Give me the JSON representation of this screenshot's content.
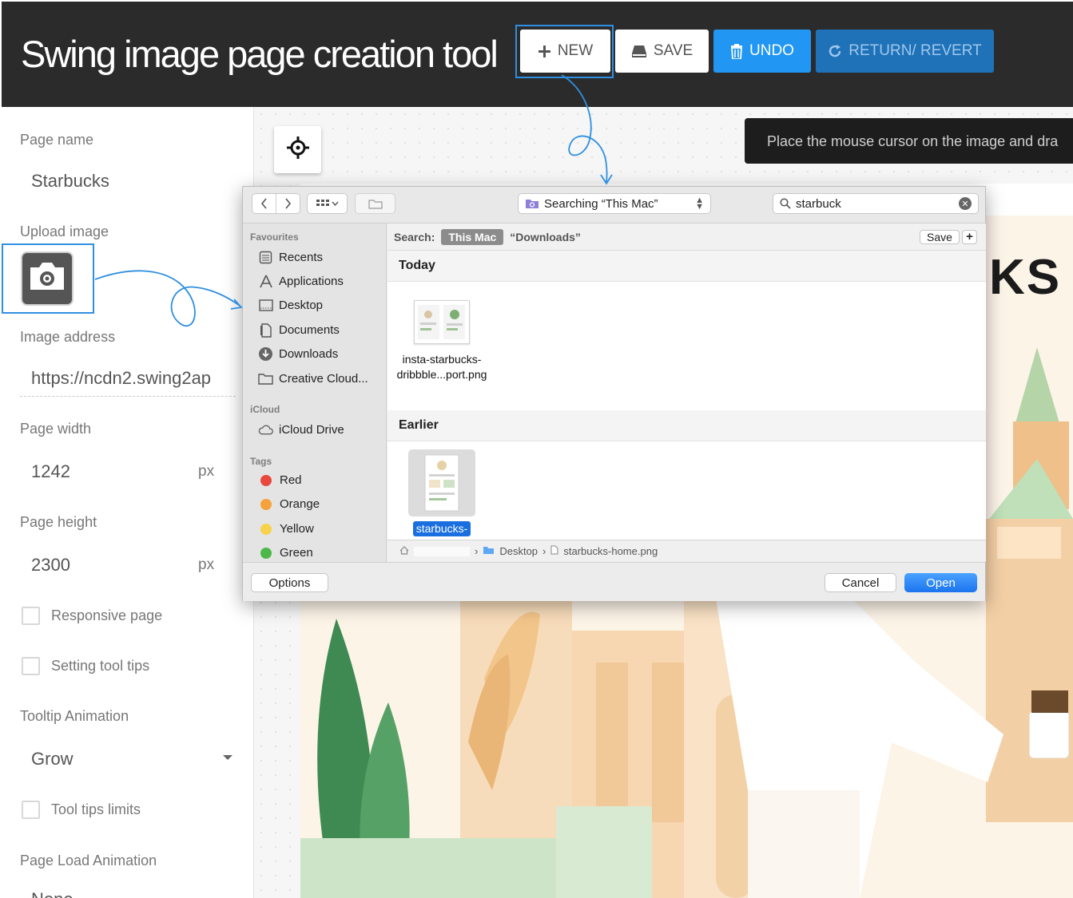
{
  "app": {
    "title": "Swing image page creation tool"
  },
  "toolbar": {
    "new_label": "NEW",
    "save_label": "SAVE",
    "undo_label": "UNDO",
    "revert_label": "RETURN/ REVERT"
  },
  "form": {
    "page_name_label": "Page name",
    "page_name_value": "Starbucks",
    "upload_label": "Upload image",
    "image_address_label": "Image address",
    "image_address_value": "https://ncdn2.swing2ap",
    "page_width_label": "Page width",
    "page_width_value": "1242",
    "page_height_label": "Page height",
    "page_height_value": "2300",
    "unit": "px",
    "responsive_label": "Responsive page",
    "tooltips_label": "Setting tool tips",
    "tooltip_anim_label": "Tooltip Animation",
    "tooltip_anim_value": "Grow",
    "tooltip_limits_label": "Tool tips limits",
    "page_load_label": "Page Load Animation",
    "page_load_value": "None"
  },
  "canvas": {
    "hint": "Place the mouse cursor on the image and dra",
    "brand_fragment": "KS"
  },
  "dialog": {
    "location": "Searching “This Mac”",
    "search_value": "starbuck",
    "sidebar": {
      "favourites_head": "Favourites",
      "favourites": [
        "Recents",
        "Applications",
        "Desktop",
        "Documents",
        "Downloads",
        "Creative Cloud..."
      ],
      "icloud_head": "iCloud",
      "icloud": [
        "iCloud Drive"
      ],
      "tags_head": "Tags",
      "tags": [
        {
          "label": "Red",
          "color": "#e8483d"
        },
        {
          "label": "Orange",
          "color": "#f5a23a"
        },
        {
          "label": "Yellow",
          "color": "#f7d24a"
        },
        {
          "label": "Green",
          "color": "#4cb84a"
        }
      ]
    },
    "scope": {
      "search_label": "Search:",
      "this_mac": "This Mac",
      "downloads": "“Downloads”",
      "save": "Save",
      "add": "+"
    },
    "groups": {
      "today": "Today",
      "earlier": "Earlier"
    },
    "files": {
      "today_line1": "insta-starbucks-",
      "today_line2": "dribbble...port.png",
      "selected": "starbucks-"
    },
    "path": {
      "separator": "›",
      "folder": "Desktop",
      "file": "starbucks-home.png"
    },
    "buttons": {
      "options": "Options",
      "cancel": "Cancel",
      "open": "Open"
    }
  },
  "colors": {
    "accent": "#2196f3",
    "annotation": "#2f8fe0",
    "topbar": "#2b2b2b"
  }
}
